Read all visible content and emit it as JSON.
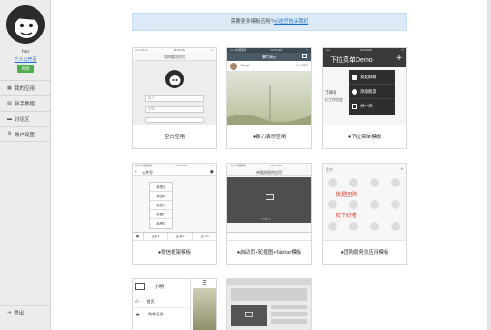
{
  "sidebar": {
    "username": "hao",
    "home_link": "个人公开页",
    "badge": "有效",
    "nav": [
      {
        "icon": "apps-icon",
        "glyph": "▦",
        "label": "我的应用"
      },
      {
        "icon": "book-icon",
        "glyph": "▤",
        "label": "新手教程"
      },
      {
        "icon": "chat-icon",
        "glyph": "▬",
        "label": "讨论区"
      },
      {
        "icon": "gear-icon",
        "glyph": "⚙",
        "label": "账户设置"
      }
    ],
    "logout": "登出"
  },
  "notice": {
    "text": "需要更多模板应用?",
    "link": "点这里告诉我们"
  },
  "cards": [
    {
      "caption": "空白应用",
      "t1": "我的酷炫应用",
      "s": "12:00 AM",
      "f1": "账户",
      "f2": "密码"
    },
    {
      "caption": "●暴力演示应用",
      "t1": "暴力演示",
      "user": "Yueryi",
      "time": "21小时前"
    },
    {
      "caption": "●下拉菜单模板",
      "t1": "下拉菜单Demo",
      "m1": "发起群聊",
      "m2": "添加朋友",
      "m3": "扫一扫",
      "side1": "订阅号",
      "side2": "行工作机会"
    },
    {
      "caption": "●微信框架模板",
      "t1": "公共号",
      "items": [
        "标签A",
        "标签B",
        "标签C",
        "标签D",
        "标签E"
      ],
      "b1": "文字1",
      "b2": "文字2",
      "b3": "文字3"
    },
    {
      "caption": "●启动页+轮播图+Tabbar模板",
      "t1": "帝酷播图的应用"
    },
    {
      "caption": "●团购服务类应用模板",
      "s1": "北京",
      "r1": "我是团购",
      "r2": "按下好看"
    },
    {
      "caption": "",
      "t1": "小明",
      "l1": "首页",
      "l2": "购物记录"
    },
    {
      "caption": ""
    }
  ]
}
